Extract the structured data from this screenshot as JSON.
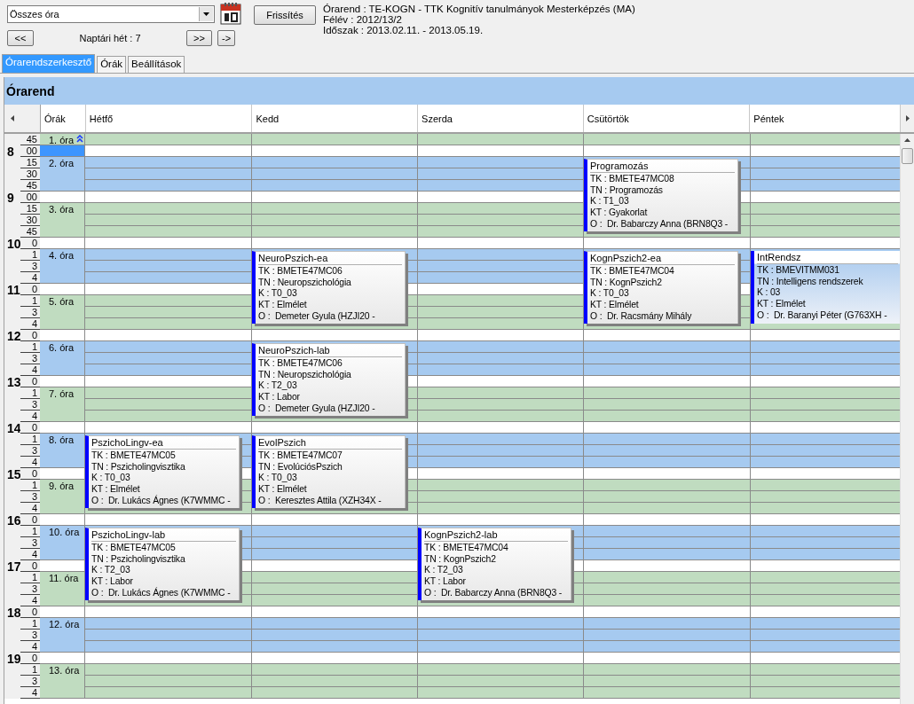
{
  "toolbar": {
    "filter": "Összes óra",
    "week_back": "<<",
    "week_label": "Naptári hét : 7",
    "week_forward": ">>",
    "go": "->",
    "refresh": "Frissítés",
    "info": [
      "Órarend : TE-KOGN - TTK Kognitív tanulmányok Mesterképzés (MA)",
      "Félév : 2012/13/2",
      "Időszak : 2013.02.11. - 2013.05.19."
    ]
  },
  "tabs": [
    {
      "label": "Órarendszerkesztő",
      "selected": true
    },
    {
      "label": "Órák",
      "selected": false
    },
    {
      "label": "Beállítások",
      "selected": false
    }
  ],
  "schedule": {
    "title": "Órarend",
    "columns": [
      "Órák",
      "Hétfő",
      "Kedd",
      "Szerda",
      "Csütörtök",
      "Péntek"
    ],
    "rows": [
      {
        "kind": "period",
        "label": "1. óra",
        "marks": [
          "45"
        ],
        "collapsible": true,
        "cells": [
          null,
          null,
          null,
          null,
          null
        ]
      },
      {
        "kind": "gap",
        "hour": "8",
        "mark": "00",
        "selected": true
      },
      {
        "kind": "period",
        "label": "2. óra",
        "marks": [
          "15",
          "30",
          "45"
        ],
        "collapsible": false,
        "cells": [
          null,
          null,
          null,
          {
            "title": "Programozás",
            "selected": false,
            "lines": [
              "TK : BMETE47MC08",
              "TN : Programozás",
              "K : T1_03",
              "KT : Gyakorlat",
              "O :  Dr. Babarczy Anna (BRN8Q3 -"
            ]
          },
          null
        ]
      },
      {
        "kind": "gap",
        "hour": "9",
        "mark": "00",
        "selected": false
      },
      {
        "kind": "period",
        "label": "3. óra",
        "marks": [
          "15",
          "30",
          "45"
        ],
        "collapsible": false,
        "cells": [
          null,
          null,
          null,
          null,
          null
        ]
      },
      {
        "kind": "gap",
        "hour": "10",
        "mark": "0",
        "selected": false
      },
      {
        "kind": "period",
        "label": "4. óra",
        "marks": [
          "1",
          "3",
          "4"
        ],
        "collapsible": false,
        "cells": [
          null,
          {
            "title": "NeuroPszich-ea",
            "selected": false,
            "lines": [
              "TK : BMETE47MC06",
              "TN : Neuropszichológia",
              "K : T0_03",
              "KT : Elmélet",
              "O :  Demeter Gyula (HZJI20 -"
            ]
          },
          null,
          {
            "title": "KognPszich2-ea",
            "selected": false,
            "lines": [
              "TK : BMETE47MC04",
              "TN : KognPszich2",
              "K : T0_03",
              "KT : Elmélet",
              "O :  Dr. Racsmány Mihály"
            ]
          },
          {
            "title": "IntRendsz",
            "selected": true,
            "lines": [
              "TK : BMEVITMM031",
              "TN : Intelligens rendszerek",
              "K : 03",
              "KT : Elmélet",
              "O :  Dr. Baranyi Péter (G763XH -"
            ]
          }
        ]
      },
      {
        "kind": "gap",
        "hour": "11",
        "mark": "0",
        "selected": false
      },
      {
        "kind": "period",
        "label": "5. óra",
        "marks": [
          "1",
          "3",
          "4"
        ],
        "collapsible": false,
        "cells": [
          null,
          null,
          null,
          null,
          null
        ]
      },
      {
        "kind": "gap",
        "hour": "12",
        "mark": "0",
        "selected": false
      },
      {
        "kind": "period",
        "label": "6. óra",
        "marks": [
          "1",
          "3",
          "4"
        ],
        "collapsible": false,
        "cells": [
          null,
          {
            "title": "NeuroPszich-lab",
            "selected": false,
            "lines": [
              "TK : BMETE47MC06",
              "TN : Neuropszichológia",
              "K : T2_03",
              "KT : Labor",
              "O :  Demeter Gyula (HZJI20 -"
            ]
          },
          null,
          null,
          null
        ]
      },
      {
        "kind": "gap",
        "hour": "13",
        "mark": "0",
        "selected": false
      },
      {
        "kind": "period",
        "label": "7. óra",
        "marks": [
          "1",
          "3",
          "4"
        ],
        "collapsible": false,
        "cells": [
          null,
          null,
          null,
          null,
          null
        ]
      },
      {
        "kind": "gap",
        "hour": "14",
        "mark": "0",
        "selected": false
      },
      {
        "kind": "period",
        "label": "8. óra",
        "marks": [
          "1",
          "3",
          "4"
        ],
        "collapsible": false,
        "cells": [
          {
            "title": "PszichoLingv-ea",
            "selected": false,
            "lines": [
              "TK : BMETE47MC05",
              "TN : Pszicholingvisztika",
              "K : T0_03",
              "KT : Elmélet",
              "O :  Dr. Lukács Ágnes (K7WMMC -"
            ]
          },
          {
            "title": "EvolPszich",
            "selected": false,
            "lines": [
              "TK : BMETE47MC07",
              "TN : EvolúciósPszich",
              "K : T0_03",
              "KT : Elmélet",
              "O :  Keresztes Attila (XZH34X -"
            ]
          },
          null,
          null,
          null
        ]
      },
      {
        "kind": "gap",
        "hour": "15",
        "mark": "0",
        "selected": false
      },
      {
        "kind": "period",
        "label": "9. óra",
        "marks": [
          "1",
          "3",
          "4"
        ],
        "collapsible": false,
        "cells": [
          null,
          null,
          null,
          null,
          null
        ]
      },
      {
        "kind": "gap",
        "hour": "16",
        "mark": "0",
        "selected": false
      },
      {
        "kind": "period",
        "label": "10. óra",
        "marks": [
          "1",
          "3",
          "4"
        ],
        "collapsible": false,
        "cells": [
          {
            "title": "PszichoLingv-lab",
            "selected": false,
            "lines": [
              "TK : BMETE47MC05",
              "TN : Pszicholingvisztika",
              "K : T2_03",
              "KT : Labor",
              "O :  Dr. Lukács Ágnes (K7WMMC -"
            ]
          },
          null,
          {
            "title": "KognPszich2-lab",
            "selected": false,
            "lines": [
              "TK : BMETE47MC04",
              "TN : KognPszich2",
              "K : T2_03",
              "KT : Labor",
              "O :  Dr. Babarczy Anna (BRN8Q3 -"
            ]
          },
          null,
          null
        ]
      },
      {
        "kind": "gap",
        "hour": "17",
        "mark": "0",
        "selected": false
      },
      {
        "kind": "period",
        "label": "11. óra",
        "marks": [
          "1",
          "3",
          "4"
        ],
        "collapsible": false,
        "cells": [
          null,
          null,
          null,
          null,
          null
        ]
      },
      {
        "kind": "gap",
        "hour": "18",
        "mark": "0",
        "selected": false
      },
      {
        "kind": "period",
        "label": "12. óra",
        "marks": [
          "1",
          "3",
          "4"
        ],
        "collapsible": false,
        "cells": [
          null,
          null,
          null,
          null,
          null
        ]
      },
      {
        "kind": "gap",
        "hour": "19",
        "mark": "0",
        "selected": false
      },
      {
        "kind": "period",
        "label": "13. óra",
        "marks": [
          "1",
          "3",
          "4"
        ],
        "collapsible": false,
        "cells": [
          null,
          null,
          null,
          null,
          null
        ]
      }
    ]
  }
}
